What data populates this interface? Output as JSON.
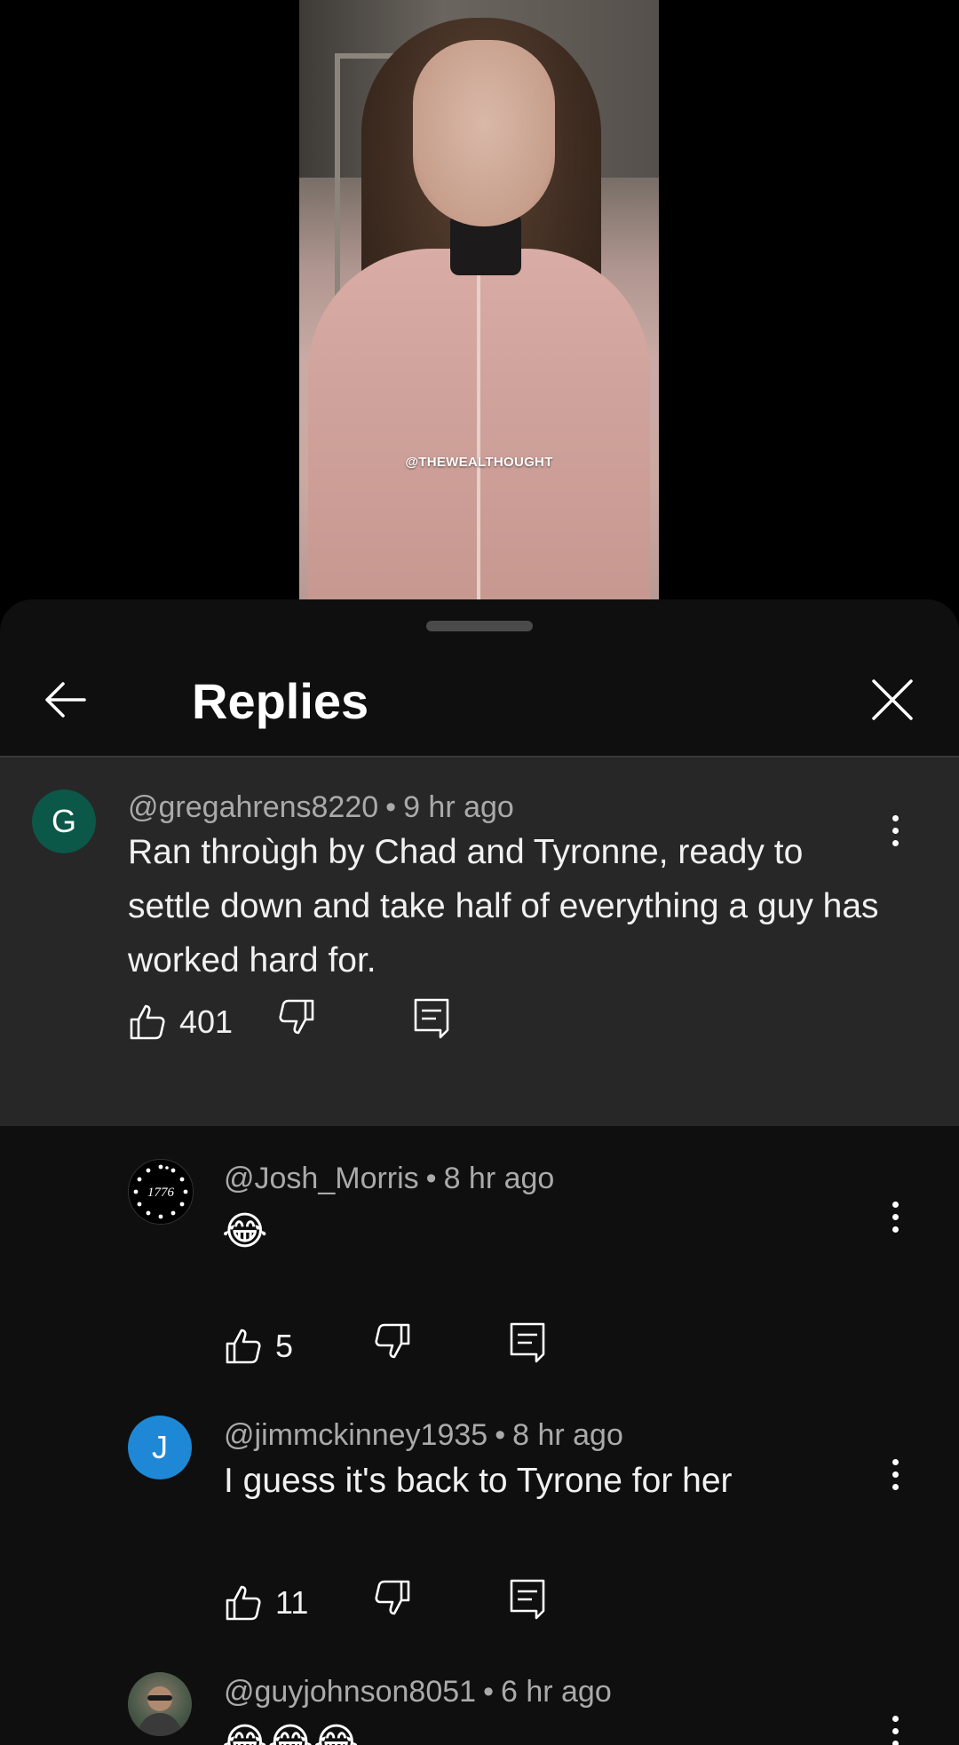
{
  "video": {
    "watermark": "@THEWEALTHOUGHT"
  },
  "sheet": {
    "title": "Replies"
  },
  "parent": {
    "avatar_letter": "G",
    "avatar_color": "#0b5748",
    "handle": "@gregahrens8220",
    "time": "9 hr ago",
    "text": "Ran throùgh by Chad and Tyronne, ready to settle down and take half of everything a guy has worked hard for.",
    "likes": "401"
  },
  "replies": [
    {
      "handle": "@Josh_Morris",
      "time": "8 hr ago",
      "text": "😂",
      "likes": "5",
      "avatar_text": "1776"
    },
    {
      "handle": "@jimmckinney1935",
      "time": "8 hr ago",
      "text": "I guess it's back to Tyrone for her",
      "likes": "11",
      "avatar_letter": "J",
      "avatar_color": "#1e88d6"
    },
    {
      "handle": "@guyjohnson8051",
      "time": "6 hr ago",
      "text": "😂😂😂"
    }
  ],
  "separator": "•"
}
